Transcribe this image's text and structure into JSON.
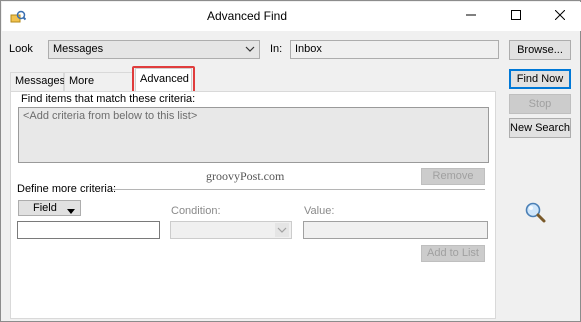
{
  "window": {
    "title": "Advanced Find",
    "icons": {
      "app": "advanced-find-app-icon",
      "minimize": "minimize-icon",
      "maximize": "maximize-icon",
      "close": "close-icon"
    }
  },
  "look": {
    "label": "Look",
    "value": "Messages",
    "in_label": "In:",
    "in_value": "Inbox",
    "browse_label": "Browse..."
  },
  "tabs": [
    {
      "label": "Messages"
    },
    {
      "label": "More Choices"
    },
    {
      "label": "Advanced"
    }
  ],
  "actions": {
    "find_now": "Find Now",
    "stop": "Stop",
    "new_search": "New Search"
  },
  "criteria": {
    "heading": "Find items that match these criteria:",
    "list_placeholder": "<Add criteria from below to this list>",
    "remove_label": "Remove",
    "watermark": "groovyPost.com"
  },
  "define": {
    "heading": "Define more criteria:",
    "field_label": "Field",
    "condition_label": "Condition:",
    "value_label": "Value:",
    "add_label": "Add to List"
  },
  "colors": {
    "highlight": "#e03c3c",
    "accent": "#0078d7"
  }
}
